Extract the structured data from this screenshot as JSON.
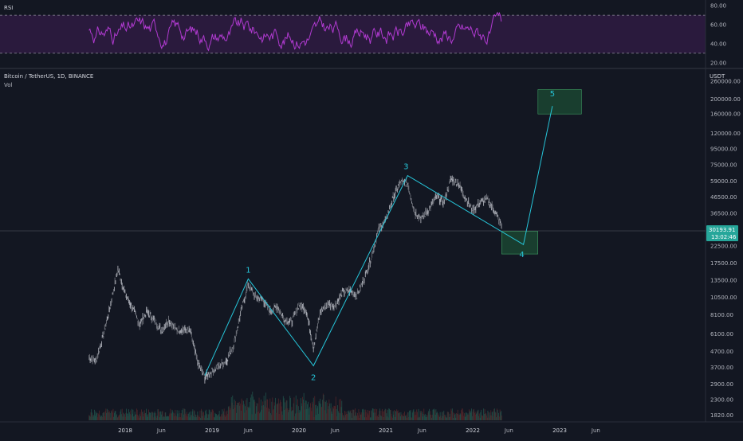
{
  "rsi_panel": {
    "label": "RSI",
    "ticks": [
      "80.00",
      "60.00",
      "40.00",
      "20.00"
    ],
    "upper_band": 70,
    "lower_band": 30
  },
  "header": {
    "symbol_line": "Bitcoin / TetherUS, 1D, BINANCE",
    "vol_label": "Vol",
    "currency": "USDT"
  },
  "price_axis": {
    "ticks": [
      "260000.00",
      "200000.00",
      "160000.00",
      "120000.00",
      "95000.00",
      "75000.00",
      "59000.00",
      "46500.00",
      "36500.00",
      "29000.00",
      "22500.00",
      "17500.00",
      "13500.00",
      "10500.00",
      "8100.00",
      "6100.00",
      "4700.00",
      "3700.00",
      "2900.00",
      "2300.00",
      "1820.00"
    ],
    "last_price": "30193.91",
    "countdown": "13:02:46"
  },
  "time_axis": {
    "labels": [
      "2018",
      "Jun",
      "2019",
      "Jun",
      "2020",
      "Jun",
      "2021",
      "Jun",
      "2022",
      "Jun",
      "2023",
      "Jun"
    ]
  },
  "waves": [
    {
      "label": "1"
    },
    {
      "label": "2"
    },
    {
      "label": "3"
    },
    {
      "label": "4"
    },
    {
      "label": "5"
    }
  ],
  "colors": {
    "background": "#131722",
    "rsi_line": "#b03ad0",
    "wave_line": "#26c6da",
    "target_box": "#1f5e3a",
    "price_badge": "#26a69a",
    "candles": "#9598a1"
  },
  "chart_data": {
    "type": "line",
    "title": "Bitcoin / TetherUS, 1D, BINANCE",
    "y_scale": "log",
    "ylim": [
      1650,
      300000
    ],
    "rsi_ylim": [
      14,
      86
    ],
    "series": [
      {
        "name": "Bitcoin / TetherUS",
        "x": [
          "2017-08",
          "2017-09",
          "2017-10",
          "2017-11",
          "2017-12",
          "2018-01",
          "2018-02",
          "2018-03",
          "2018-04",
          "2018-05",
          "2018-06",
          "2018-07",
          "2018-08",
          "2018-09",
          "2018-10",
          "2018-11",
          "2018-12",
          "2019-01",
          "2019-02",
          "2019-03",
          "2019-04",
          "2019-05",
          "2019-06",
          "2019-07",
          "2019-08",
          "2019-09",
          "2019-10",
          "2019-11",
          "2019-12",
          "2020-01",
          "2020-02",
          "2020-03",
          "2020-04",
          "2020-05",
          "2020-06",
          "2020-07",
          "2020-08",
          "2020-09",
          "2020-10",
          "2020-11",
          "2020-12",
          "2021-01",
          "2021-02",
          "2021-03",
          "2021-04",
          "2021-05",
          "2021-06",
          "2021-07",
          "2021-08",
          "2021-09",
          "2021-10",
          "2021-11",
          "2021-12",
          "2022-01",
          "2022-02",
          "2022-03",
          "2022-04",
          "2022-05"
        ],
        "values": [
          4300,
          4100,
          6000,
          9500,
          16000,
          11000,
          9000,
          7000,
          8500,
          7500,
          6400,
          7500,
          6500,
          6500,
          6300,
          4000,
          3200,
          3500,
          3800,
          4100,
          5200,
          8500,
          12800,
          10500,
          10200,
          8500,
          9200,
          7500,
          7300,
          9400,
          8700,
          5000,
          8600,
          9500,
          9300,
          11300,
          11600,
          10800,
          13700,
          19000,
          29000,
          33000,
          46000,
          58000,
          57000,
          37000,
          34000,
          39000,
          47000,
          43000,
          61000,
          57000,
          46000,
          38000,
          43000,
          45000,
          38000,
          30200
        ]
      }
    ],
    "waves": [
      {
        "label": "1",
        "x": "2019-06",
        "y": 13800
      },
      {
        "label": "2",
        "x": "2020-03",
        "y": 3800
      },
      {
        "label": "3",
        "x": "2021-04",
        "y": 64000
      },
      {
        "label": "4",
        "x": "2022-08",
        "y": 23000
      },
      {
        "label": "5",
        "x": "2022-12",
        "y": 180000
      }
    ],
    "target_zones": [
      {
        "x_from": "2022-05",
        "x_to": "2022-10",
        "y_from": 20000,
        "y_to": 28000
      },
      {
        "x_from": "2022-10",
        "x_to": "2023-04",
        "y_from": 160000,
        "y_to": 230000
      }
    ],
    "rsi_band": [
      30,
      70
    ]
  }
}
